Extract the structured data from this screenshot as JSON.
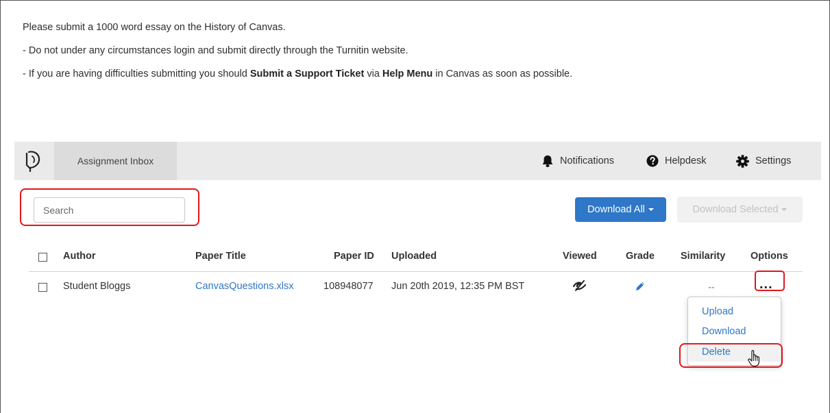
{
  "instructions": {
    "line1": "Please submit a 1000 word essay on the History of Canvas.",
    "line2": "- Do not under any circumstances login and submit directly through the Turnitin website.",
    "line3_pre": "- If you are having difficulties submitting you should ",
    "line3_b1": "Submit a Support Ticket",
    "line3_mid": " via ",
    "line3_b2": "Help Menu",
    "line3_post": " in Canvas as soon as possible."
  },
  "toolbar": {
    "tab_label": "Assignment Inbox",
    "notifications": "Notifications",
    "helpdesk": "Helpdesk",
    "settings": "Settings"
  },
  "search": {
    "placeholder": "Search",
    "value": ""
  },
  "buttons": {
    "download_all": "Download All",
    "download_selected": "Download Selected"
  },
  "table": {
    "headers": {
      "author": "Author",
      "paper_title": "Paper Title",
      "paper_id": "Paper ID",
      "uploaded": "Uploaded",
      "viewed": "Viewed",
      "grade": "Grade",
      "similarity": "Similarity",
      "options": "Options"
    },
    "rows": [
      {
        "author": "Student Bloggs",
        "paper_title": "CanvasQuestions.xlsx",
        "paper_id": "108948077",
        "uploaded": "Jun 20th 2019, 12:35 PM BST",
        "viewed_icon": "not-viewed-eye-icon",
        "grade_icon": "pencil-icon",
        "similarity": "--",
        "options": "..."
      }
    ]
  },
  "options_menu": {
    "items": [
      "Upload",
      "Download",
      "Delete"
    ],
    "hovered": "Delete"
  },
  "colors": {
    "accent": "#2f77c8",
    "highlight": "#e0161a",
    "toolbar_bg": "#eaeaea"
  }
}
